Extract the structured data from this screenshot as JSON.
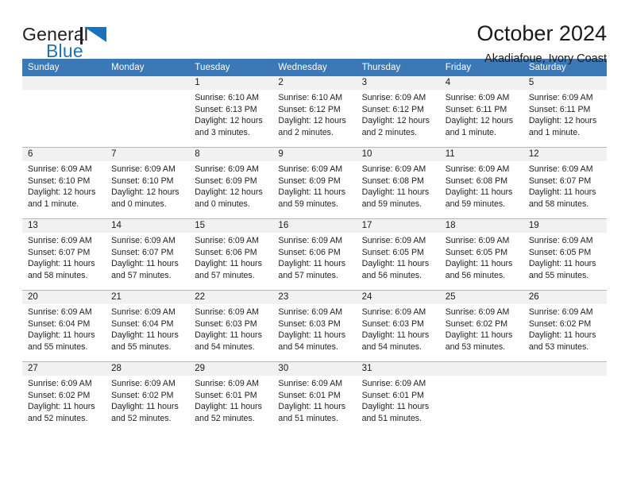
{
  "brand": {
    "name_top": "General",
    "name_bottom": "Blue",
    "flag_icon": "blue-triangle-flag",
    "accent_color": "#1c72b8",
    "text_color": "#231f20"
  },
  "header": {
    "title": "October 2024",
    "subtitle": "Akadiafoue, Ivory Coast"
  },
  "calendar": {
    "header_bg": "#3b78b5",
    "daynum_bg": "#f1f1f1",
    "weekdays": [
      "Sunday",
      "Monday",
      "Tuesday",
      "Wednesday",
      "Thursday",
      "Friday",
      "Saturday"
    ],
    "weeks": [
      [
        {
          "day": "",
          "sunrise": "",
          "sunset": "",
          "daylight_1": "",
          "daylight_2": ""
        },
        {
          "day": "",
          "sunrise": "",
          "sunset": "",
          "daylight_1": "",
          "daylight_2": ""
        },
        {
          "day": "1",
          "sunrise": "Sunrise: 6:10 AM",
          "sunset": "Sunset: 6:13 PM",
          "daylight_1": "Daylight: 12 hours",
          "daylight_2": "and 3 minutes."
        },
        {
          "day": "2",
          "sunrise": "Sunrise: 6:10 AM",
          "sunset": "Sunset: 6:12 PM",
          "daylight_1": "Daylight: 12 hours",
          "daylight_2": "and 2 minutes."
        },
        {
          "day": "3",
          "sunrise": "Sunrise: 6:09 AM",
          "sunset": "Sunset: 6:12 PM",
          "daylight_1": "Daylight: 12 hours",
          "daylight_2": "and 2 minutes."
        },
        {
          "day": "4",
          "sunrise": "Sunrise: 6:09 AM",
          "sunset": "Sunset: 6:11 PM",
          "daylight_1": "Daylight: 12 hours",
          "daylight_2": "and 1 minute."
        },
        {
          "day": "5",
          "sunrise": "Sunrise: 6:09 AM",
          "sunset": "Sunset: 6:11 PM",
          "daylight_1": "Daylight: 12 hours",
          "daylight_2": "and 1 minute."
        }
      ],
      [
        {
          "day": "6",
          "sunrise": "Sunrise: 6:09 AM",
          "sunset": "Sunset: 6:10 PM",
          "daylight_1": "Daylight: 12 hours",
          "daylight_2": "and 1 minute."
        },
        {
          "day": "7",
          "sunrise": "Sunrise: 6:09 AM",
          "sunset": "Sunset: 6:10 PM",
          "daylight_1": "Daylight: 12 hours",
          "daylight_2": "and 0 minutes."
        },
        {
          "day": "8",
          "sunrise": "Sunrise: 6:09 AM",
          "sunset": "Sunset: 6:09 PM",
          "daylight_1": "Daylight: 12 hours",
          "daylight_2": "and 0 minutes."
        },
        {
          "day": "9",
          "sunrise": "Sunrise: 6:09 AM",
          "sunset": "Sunset: 6:09 PM",
          "daylight_1": "Daylight: 11 hours",
          "daylight_2": "and 59 minutes."
        },
        {
          "day": "10",
          "sunrise": "Sunrise: 6:09 AM",
          "sunset": "Sunset: 6:08 PM",
          "daylight_1": "Daylight: 11 hours",
          "daylight_2": "and 59 minutes."
        },
        {
          "day": "11",
          "sunrise": "Sunrise: 6:09 AM",
          "sunset": "Sunset: 6:08 PM",
          "daylight_1": "Daylight: 11 hours",
          "daylight_2": "and 59 minutes."
        },
        {
          "day": "12",
          "sunrise": "Sunrise: 6:09 AM",
          "sunset": "Sunset: 6:07 PM",
          "daylight_1": "Daylight: 11 hours",
          "daylight_2": "and 58 minutes."
        }
      ],
      [
        {
          "day": "13",
          "sunrise": "Sunrise: 6:09 AM",
          "sunset": "Sunset: 6:07 PM",
          "daylight_1": "Daylight: 11 hours",
          "daylight_2": "and 58 minutes."
        },
        {
          "day": "14",
          "sunrise": "Sunrise: 6:09 AM",
          "sunset": "Sunset: 6:07 PM",
          "daylight_1": "Daylight: 11 hours",
          "daylight_2": "and 57 minutes."
        },
        {
          "day": "15",
          "sunrise": "Sunrise: 6:09 AM",
          "sunset": "Sunset: 6:06 PM",
          "daylight_1": "Daylight: 11 hours",
          "daylight_2": "and 57 minutes."
        },
        {
          "day": "16",
          "sunrise": "Sunrise: 6:09 AM",
          "sunset": "Sunset: 6:06 PM",
          "daylight_1": "Daylight: 11 hours",
          "daylight_2": "and 57 minutes."
        },
        {
          "day": "17",
          "sunrise": "Sunrise: 6:09 AM",
          "sunset": "Sunset: 6:05 PM",
          "daylight_1": "Daylight: 11 hours",
          "daylight_2": "and 56 minutes."
        },
        {
          "day": "18",
          "sunrise": "Sunrise: 6:09 AM",
          "sunset": "Sunset: 6:05 PM",
          "daylight_1": "Daylight: 11 hours",
          "daylight_2": "and 56 minutes."
        },
        {
          "day": "19",
          "sunrise": "Sunrise: 6:09 AM",
          "sunset": "Sunset: 6:05 PM",
          "daylight_1": "Daylight: 11 hours",
          "daylight_2": "and 55 minutes."
        }
      ],
      [
        {
          "day": "20",
          "sunrise": "Sunrise: 6:09 AM",
          "sunset": "Sunset: 6:04 PM",
          "daylight_1": "Daylight: 11 hours",
          "daylight_2": "and 55 minutes."
        },
        {
          "day": "21",
          "sunrise": "Sunrise: 6:09 AM",
          "sunset": "Sunset: 6:04 PM",
          "daylight_1": "Daylight: 11 hours",
          "daylight_2": "and 55 minutes."
        },
        {
          "day": "22",
          "sunrise": "Sunrise: 6:09 AM",
          "sunset": "Sunset: 6:03 PM",
          "daylight_1": "Daylight: 11 hours",
          "daylight_2": "and 54 minutes."
        },
        {
          "day": "23",
          "sunrise": "Sunrise: 6:09 AM",
          "sunset": "Sunset: 6:03 PM",
          "daylight_1": "Daylight: 11 hours",
          "daylight_2": "and 54 minutes."
        },
        {
          "day": "24",
          "sunrise": "Sunrise: 6:09 AM",
          "sunset": "Sunset: 6:03 PM",
          "daylight_1": "Daylight: 11 hours",
          "daylight_2": "and 54 minutes."
        },
        {
          "day": "25",
          "sunrise": "Sunrise: 6:09 AM",
          "sunset": "Sunset: 6:02 PM",
          "daylight_1": "Daylight: 11 hours",
          "daylight_2": "and 53 minutes."
        },
        {
          "day": "26",
          "sunrise": "Sunrise: 6:09 AM",
          "sunset": "Sunset: 6:02 PM",
          "daylight_1": "Daylight: 11 hours",
          "daylight_2": "and 53 minutes."
        }
      ],
      [
        {
          "day": "27",
          "sunrise": "Sunrise: 6:09 AM",
          "sunset": "Sunset: 6:02 PM",
          "daylight_1": "Daylight: 11 hours",
          "daylight_2": "and 52 minutes."
        },
        {
          "day": "28",
          "sunrise": "Sunrise: 6:09 AM",
          "sunset": "Sunset: 6:02 PM",
          "daylight_1": "Daylight: 11 hours",
          "daylight_2": "and 52 minutes."
        },
        {
          "day": "29",
          "sunrise": "Sunrise: 6:09 AM",
          "sunset": "Sunset: 6:01 PM",
          "daylight_1": "Daylight: 11 hours",
          "daylight_2": "and 52 minutes."
        },
        {
          "day": "30",
          "sunrise": "Sunrise: 6:09 AM",
          "sunset": "Sunset: 6:01 PM",
          "daylight_1": "Daylight: 11 hours",
          "daylight_2": "and 51 minutes."
        },
        {
          "day": "31",
          "sunrise": "Sunrise: 6:09 AM",
          "sunset": "Sunset: 6:01 PM",
          "daylight_1": "Daylight: 11 hours",
          "daylight_2": "and 51 minutes."
        },
        {
          "day": "",
          "sunrise": "",
          "sunset": "",
          "daylight_1": "",
          "daylight_2": ""
        },
        {
          "day": "",
          "sunrise": "",
          "sunset": "",
          "daylight_1": "",
          "daylight_2": ""
        }
      ]
    ]
  }
}
